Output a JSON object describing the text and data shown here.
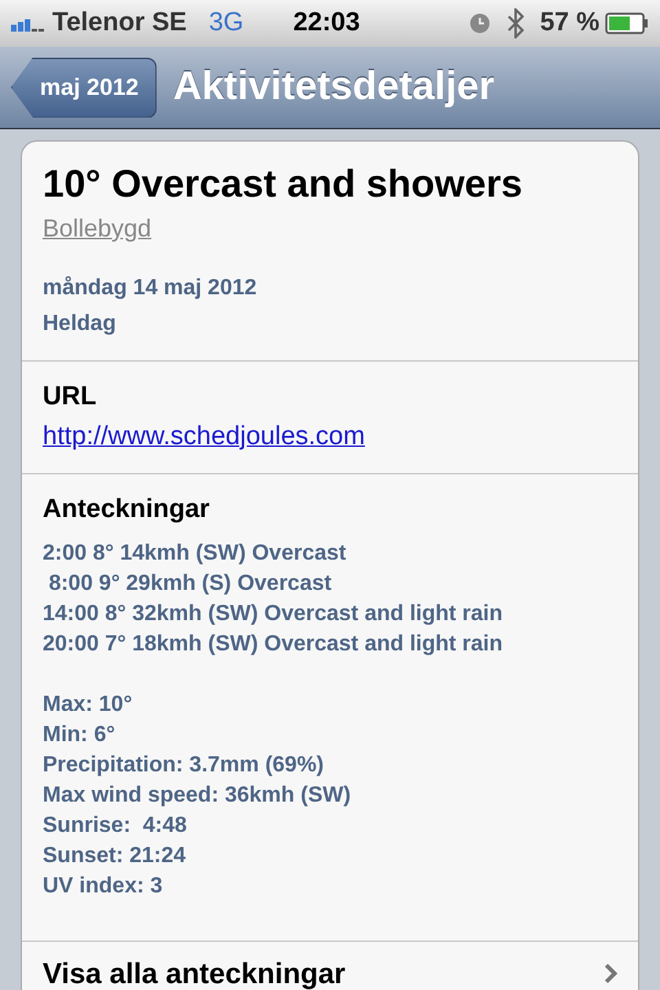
{
  "status_bar": {
    "carrier": "Telenor SE",
    "network": "3G",
    "time": "22:03",
    "battery": "57 %"
  },
  "nav_bar": {
    "back": "maj 2012",
    "title": "Aktivitetsdetaljer"
  },
  "event": {
    "title": "10° Overcast and showers",
    "location": "Bollebygd",
    "date": "måndag 14 maj 2012",
    "duration": "Heldag"
  },
  "url_section": {
    "label": "URL",
    "link": "http://www.schedjoules.com"
  },
  "notes_section": {
    "label": "Anteckningar",
    "forecast": [
      "2:00 8° 14kmh (SW) Overcast",
      " 8:00 9° 29kmh (S) Overcast",
      "14:00 8° 32kmh (SW) Overcast and light rain",
      "20:00 7° 18kmh (SW) Overcast and light rain"
    ],
    "summary": [
      "Max: 10°",
      "Min: 6°",
      "Precipitation: 3.7mm (69%)",
      "Max wind speed: 36kmh (SW)",
      "Sunrise:  4:48",
      "Sunset: 21:24",
      "UV index: 3"
    ]
  },
  "show_all": {
    "label": "Visa alla anteckningar"
  }
}
